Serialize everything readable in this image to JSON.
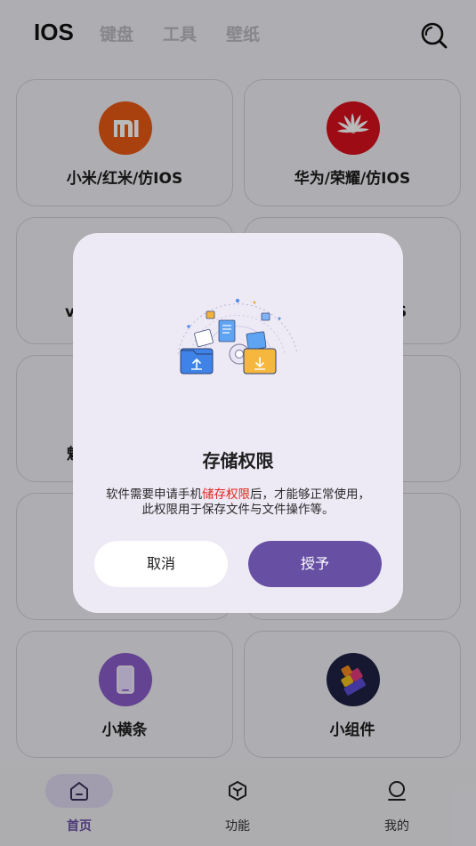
{
  "header": {
    "tabs": [
      {
        "label": "IOS",
        "active": true
      },
      {
        "label": "键盘",
        "active": false
      },
      {
        "label": "工具",
        "active": false
      },
      {
        "label": "壁纸",
        "active": false
      }
    ],
    "search_icon": "search-icon"
  },
  "cards": [
    {
      "label": "小米/红米/仿IOS",
      "icon": "xiaomi-logo",
      "color": "#e85a14"
    },
    {
      "label": "华为/荣耀/仿IOS",
      "icon": "huawei-logo",
      "color": "#d7101e"
    },
    {
      "label": "v",
      "icon": "vivo-logo"
    },
    {
      "label": "S",
      "icon": "oppo-logo"
    },
    {
      "label": "魅",
      "icon": "meizu-logo"
    },
    {
      "label": "",
      "icon": ""
    },
    {
      "label": "",
      "icon": ""
    },
    {
      "label": "",
      "icon": ""
    },
    {
      "label": "小横条",
      "icon": "phone-icon",
      "color": "#8a5cc9"
    },
    {
      "label": "小组件",
      "icon": "widget-icon",
      "color": "#1d2142"
    }
  ],
  "dialog": {
    "title": "存储权限",
    "message_before": "软件需要申请手机",
    "message_highlight": "储存权限",
    "message_after": "后，才能够正常使用，",
    "message_line2": "此权限用于保存文件与文件操作等。",
    "cancel_label": "取消",
    "grant_label": "授予",
    "accent_color": "#6750a4",
    "highlight_color": "#e0261d"
  },
  "bottom_nav": [
    {
      "label": "首页",
      "icon": "home-icon",
      "active": true
    },
    {
      "label": "功能",
      "icon": "cube-icon",
      "active": false
    },
    {
      "label": "我的",
      "icon": "person-icon",
      "active": false
    }
  ]
}
